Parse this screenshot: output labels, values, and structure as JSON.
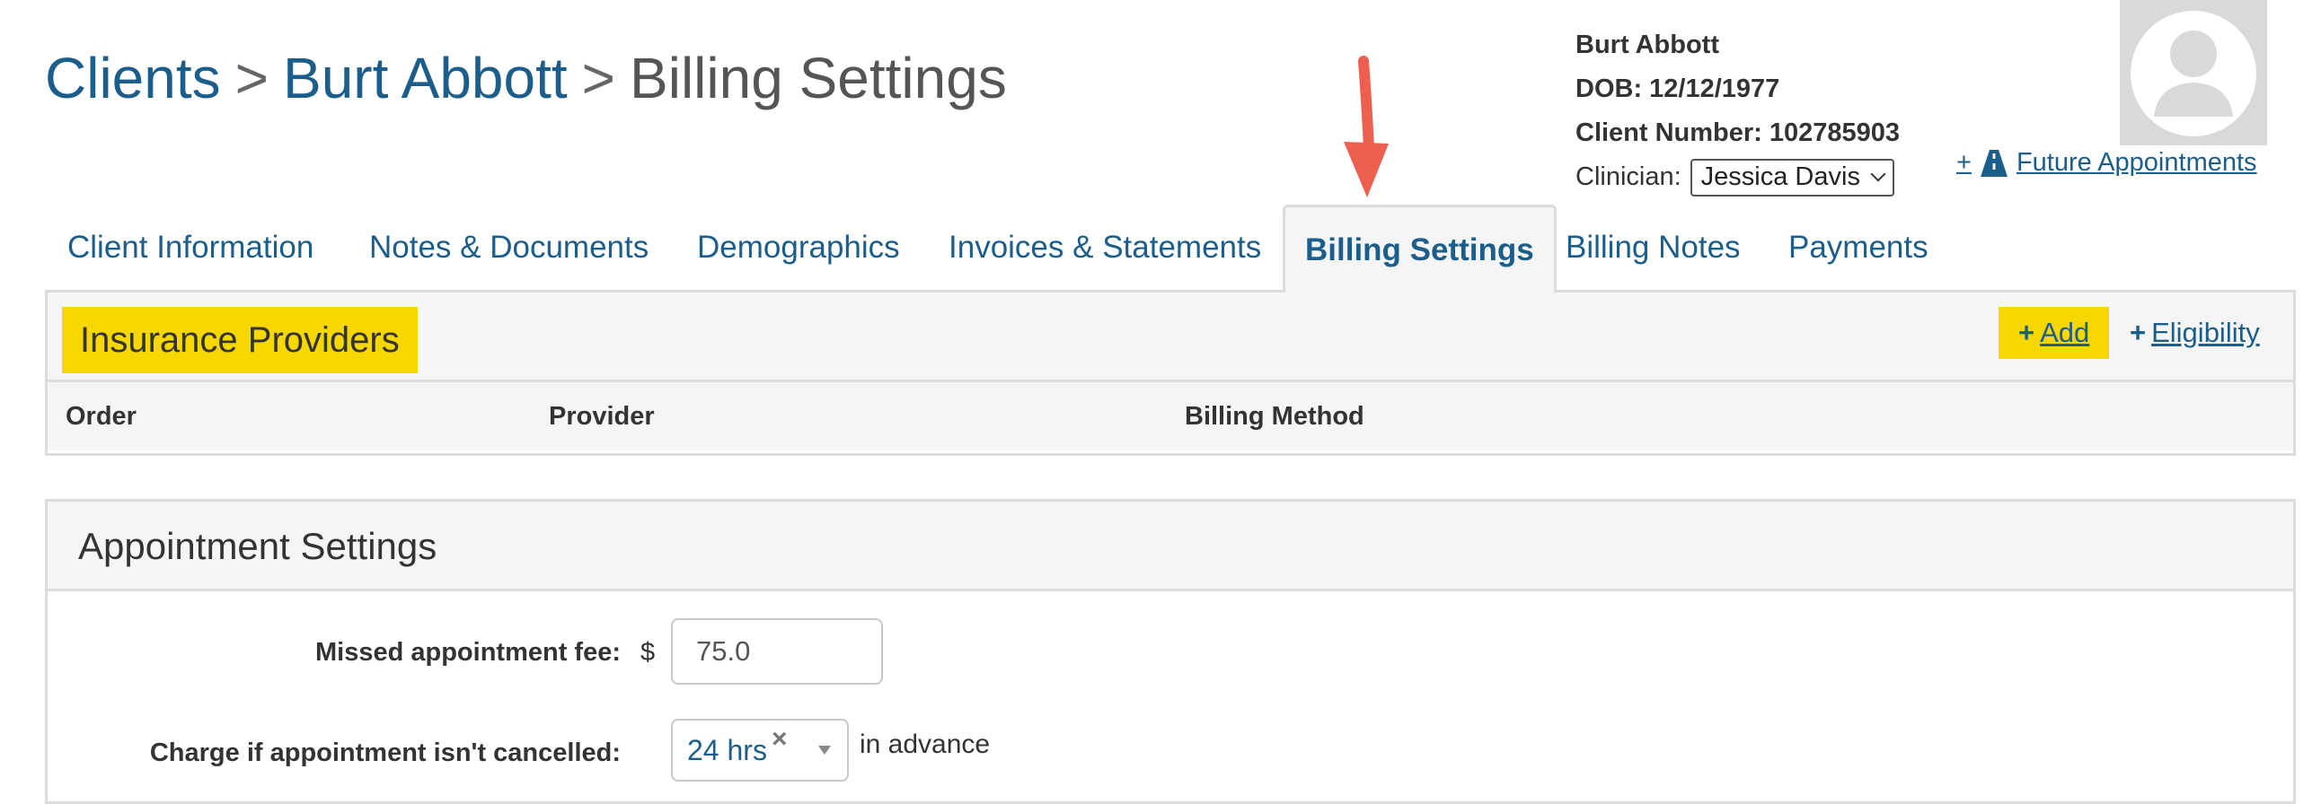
{
  "breadcrumb": {
    "clients": "Clients",
    "client_name": "Burt Abbott",
    "current": "Billing Settings",
    "separator": ">"
  },
  "client": {
    "name": "Burt Abbott",
    "dob_label": "DOB:",
    "dob": "12/12/1977",
    "number_label": "Client Number:",
    "number": "102785903",
    "clinician_label": "Clinician:",
    "clinician": "Jessica Davis"
  },
  "future_appointments": {
    "plus": "+",
    "label": "Future Appointments",
    "icon": "road-icon"
  },
  "tabs": [
    {
      "label": "Client Information"
    },
    {
      "label": "Notes & Documents"
    },
    {
      "label": "Demographics"
    },
    {
      "label": "Invoices & Statements"
    },
    {
      "label": "Billing Settings",
      "active": true
    },
    {
      "label": "Billing Notes"
    },
    {
      "label": "Payments"
    }
  ],
  "insurance": {
    "title": "Insurance Providers",
    "add_label": "Add",
    "eligibility_label": "Eligibility",
    "columns": [
      "Order",
      "Provider",
      "Billing Method"
    ]
  },
  "appointment_settings": {
    "title": "Appointment Settings",
    "missed_fee_label": "Missed appointment fee:",
    "currency": "$",
    "missed_fee_value": "75.0",
    "charge_label": "Charge if appointment isn't cancelled:",
    "charge_value": "24 hrs",
    "clear_glyph": "×",
    "advance_text": "in advance"
  },
  "colors": {
    "link": "#1b5e8c",
    "highlight": "#f7d700",
    "arrow": "#ee5f4f",
    "panel_bg": "#f5f5f5",
    "border": "#dcdcdc"
  }
}
